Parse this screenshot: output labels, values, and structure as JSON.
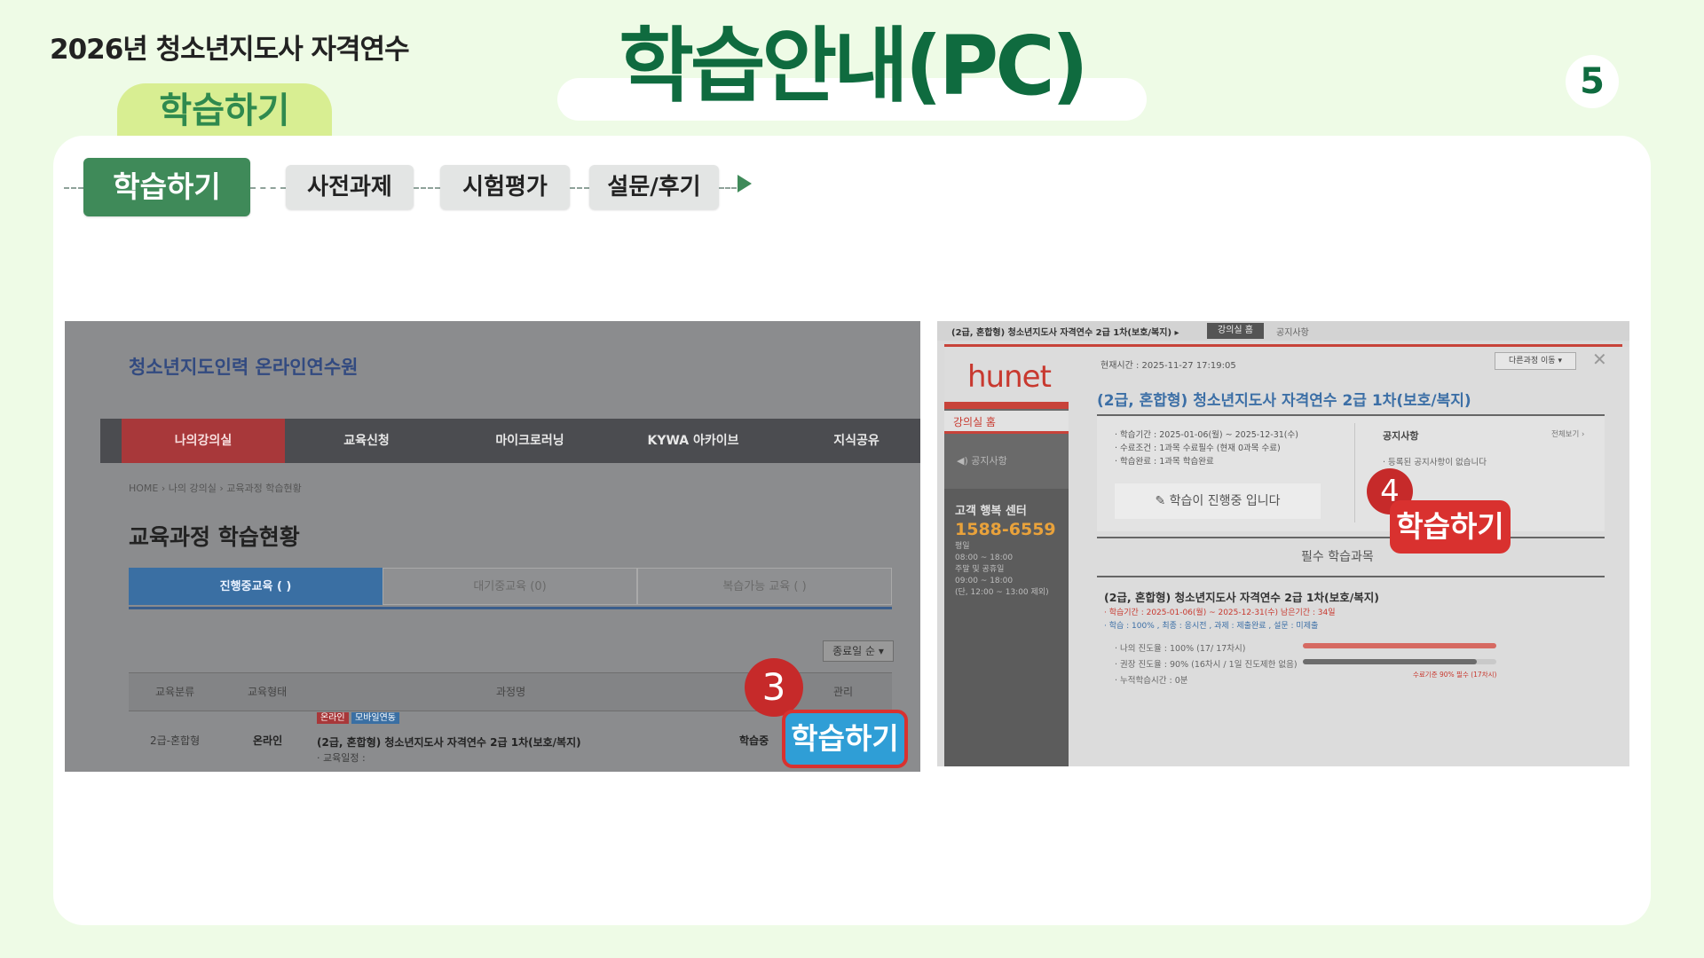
{
  "header": {
    "course": "2026년 청소년지도사 자격연수",
    "title": "학습안내(PC)",
    "page_number": "5",
    "section_tab": "학습하기"
  },
  "flow": {
    "steps": [
      "학습하기",
      "사전과제",
      "시험평가",
      "설문/후기"
    ],
    "active_index": 0
  },
  "left_screenshot": {
    "site_title": "청소년지도인력 온라인연수원",
    "nav": [
      "나의강의실",
      "교육신청",
      "마이크로러닝",
      "KYWA 아카이브",
      "지식공유"
    ],
    "breadcrumb": "HOME  ›  나의 강의실  ›  교육과정 학습현황",
    "page_title": "교육과정 학습현황",
    "tabs": [
      "진행중교육 (    )",
      "대기중교육 (0)",
      "복습가능 교육 ( )"
    ],
    "sort": "종료일 순",
    "table_headers": [
      "교육분류",
      "교육형태",
      "과정명",
      "관리"
    ],
    "row": {
      "category": "2급-혼합형",
      "type": "온라인",
      "tag1": "온라인",
      "tag2": "모바일연동",
      "course": "(2급, 혼합형) 청소년지도사 자격연수 2급 1차(보호/복지)",
      "schedule": "· 교육일정 :",
      "status": "학습중"
    },
    "marker": "3",
    "cta": "학습하기"
  },
  "right_screenshot": {
    "topbar_crumb": "(2급, 혼합형) 청소년지도사 자격연수 2급 1차(보호/복지)  ▸",
    "topbar_home": "강의실 홈",
    "topbar_notice": "공지사항",
    "logo": "hunet",
    "side_home": "강의실 홈",
    "side_notice": "공지사항",
    "cs_title": "고객 행복 센터",
    "cs_phone": "1588-6559",
    "cs_hours": [
      "평일",
      "08:00 ~ 18:00",
      "주말 및 공휴일",
      "09:00 ~ 18:00",
      "(단, 12:00 ~ 13:00 제외)"
    ],
    "current_time": "현재시간 : 2025-11-27 17:19:05",
    "other_course": "다른과정 이동",
    "course_title": "(2급, 혼합형) 청소년지도사 자격연수 2급 1차(보호/복지)",
    "info_lines": [
      "· 학습기간 : 2025-01-06(월) ~ 2025-12-31(수)",
      "· 수료조건 : 1과목 수료필수 (현재 0과목 수료)",
      "· 학습완료 : 1과목 학습완료"
    ],
    "notice_title": "공지사항",
    "notice_more": "전체보기 ›",
    "notice_empty": "· 등록된 공지사항이 없습니다",
    "progress_status": "학습이 진행중 입니다",
    "required_label": "필수 학습과목",
    "sub_course": "(2급, 혼합형) 청소년지도사 자격연수 2급 1차(보호/복지)",
    "sub_period": "· 학습기간 : 2025-01-06(월) ~ 2025-12-31(수) 남은기간 : 34일",
    "sub_status": "· 학습 : 100% , 최종 : 응시전 , 과제 : 제출완료 , 설문 : 미제출",
    "my_progress": "· 나의 진도율 : 100% (17/ 17차시)",
    "rec_progress": "· 권장 진도율 : 90% (16차시 / 1일 진도제한 없음)",
    "total_time": "· 누적학습시간 : 0분",
    "completion_note": "수료기준 90% 필수 (17차시)",
    "my_progress_value": 1.0,
    "rec_progress_value": 0.9,
    "marker": "4",
    "cta": "학습하기"
  }
}
